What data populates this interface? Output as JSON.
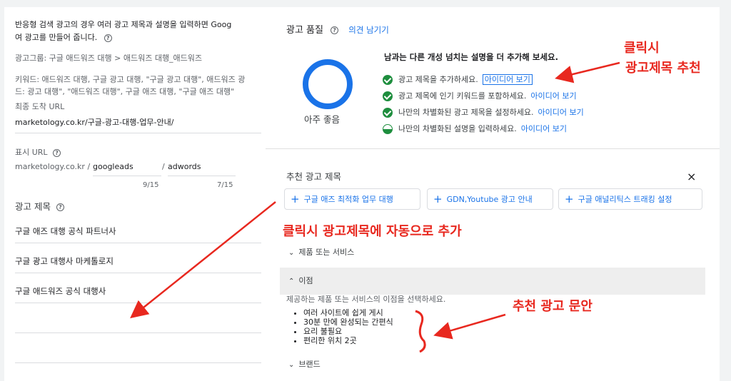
{
  "left": {
    "desc_line1": "반응형 검색 광고의 경우 여러 광고 제목과 설명을 입력하면 Goog",
    "desc_line2": "여 광고를 만들어 줍니다.",
    "adgroup": "광고그룹: 구글 애드워즈 대행 > 애드워즈 대행_애드워즈",
    "keywords_line1": "키워드: 애드워즈 대행, 구글 광고 대행, \"구글 광고 대행\", 애드워즈 광",
    "keywords_line2": "드:  광고 대행\", \"애드워즈 대행\", 구글 애즈 대행, \"구글 애즈 대행\"",
    "final_url_label": "최종 도착 URL",
    "final_url_value": "marketology.co.kr/구글-광고-대행-업무-안내/",
    "display_url_label": "표시 URL",
    "display_url_domain": "marketology.co.kr /",
    "path1": "googleads",
    "path_sep": "/",
    "path2": "adwords",
    "path1_count": "9/15",
    "path2_count": "7/15",
    "headlines_label": "광고 제목",
    "headlines": [
      "구글 애즈 대행 공식 파트너사",
      "구글 광고 대행사 마케톨로지",
      "구글 애드워즈 공식 대행사"
    ]
  },
  "quality": {
    "title": "광고 품질",
    "feedback_link": "의견 남기기",
    "rating": "아주 좋음",
    "tips_title": "남과는 다른 개성 넘치는 설명을 더 추가해 보세요.",
    "tips": [
      {
        "text": "광고 제목을 추가하세요.",
        "link": "아이디어 보기"
      },
      {
        "text": "광고 제목에 인기 키워드를 포함하세요.",
        "link": "아이디어 보기"
      },
      {
        "text": "나만의 차별화된 광고 제목을 설정하세요.",
        "link": "아이디어 보기"
      },
      {
        "text": "나만의 차별화된 설명을 입력하세요.",
        "link": "아이디어 보기"
      }
    ]
  },
  "suggestions": {
    "title": "추천 광고 제목",
    "close": "×",
    "chips": [
      "구글 애즈 최적화 업무 대행",
      "GDN,Youtube 광고 안내",
      "구글 애널리틱스 트래킹 설정"
    ],
    "sections": [
      {
        "label": "제품 또는 서비스"
      },
      {
        "label": "이점"
      },
      {
        "label": "브랜드"
      }
    ],
    "benefit_desc": "제공하는 제품 또는 서비스의 이점을 선택하세요.",
    "benefits": [
      "여러 사이트에 쉽게 게시",
      "30분 만에 완성되는 간편식",
      "요리 불필요",
      "편리한 위치 2곳"
    ]
  },
  "annotations": {
    "a1_line1": "클릭시",
    "a1_line2": "광고제목  추천",
    "a2": "클릭시  광고제목에  자동으로  추가",
    "a3": "추천  광고  문안"
  },
  "colors": {
    "accent": "#1a73e8",
    "success": "#1e8e3e",
    "annotation": "#e8281f"
  }
}
